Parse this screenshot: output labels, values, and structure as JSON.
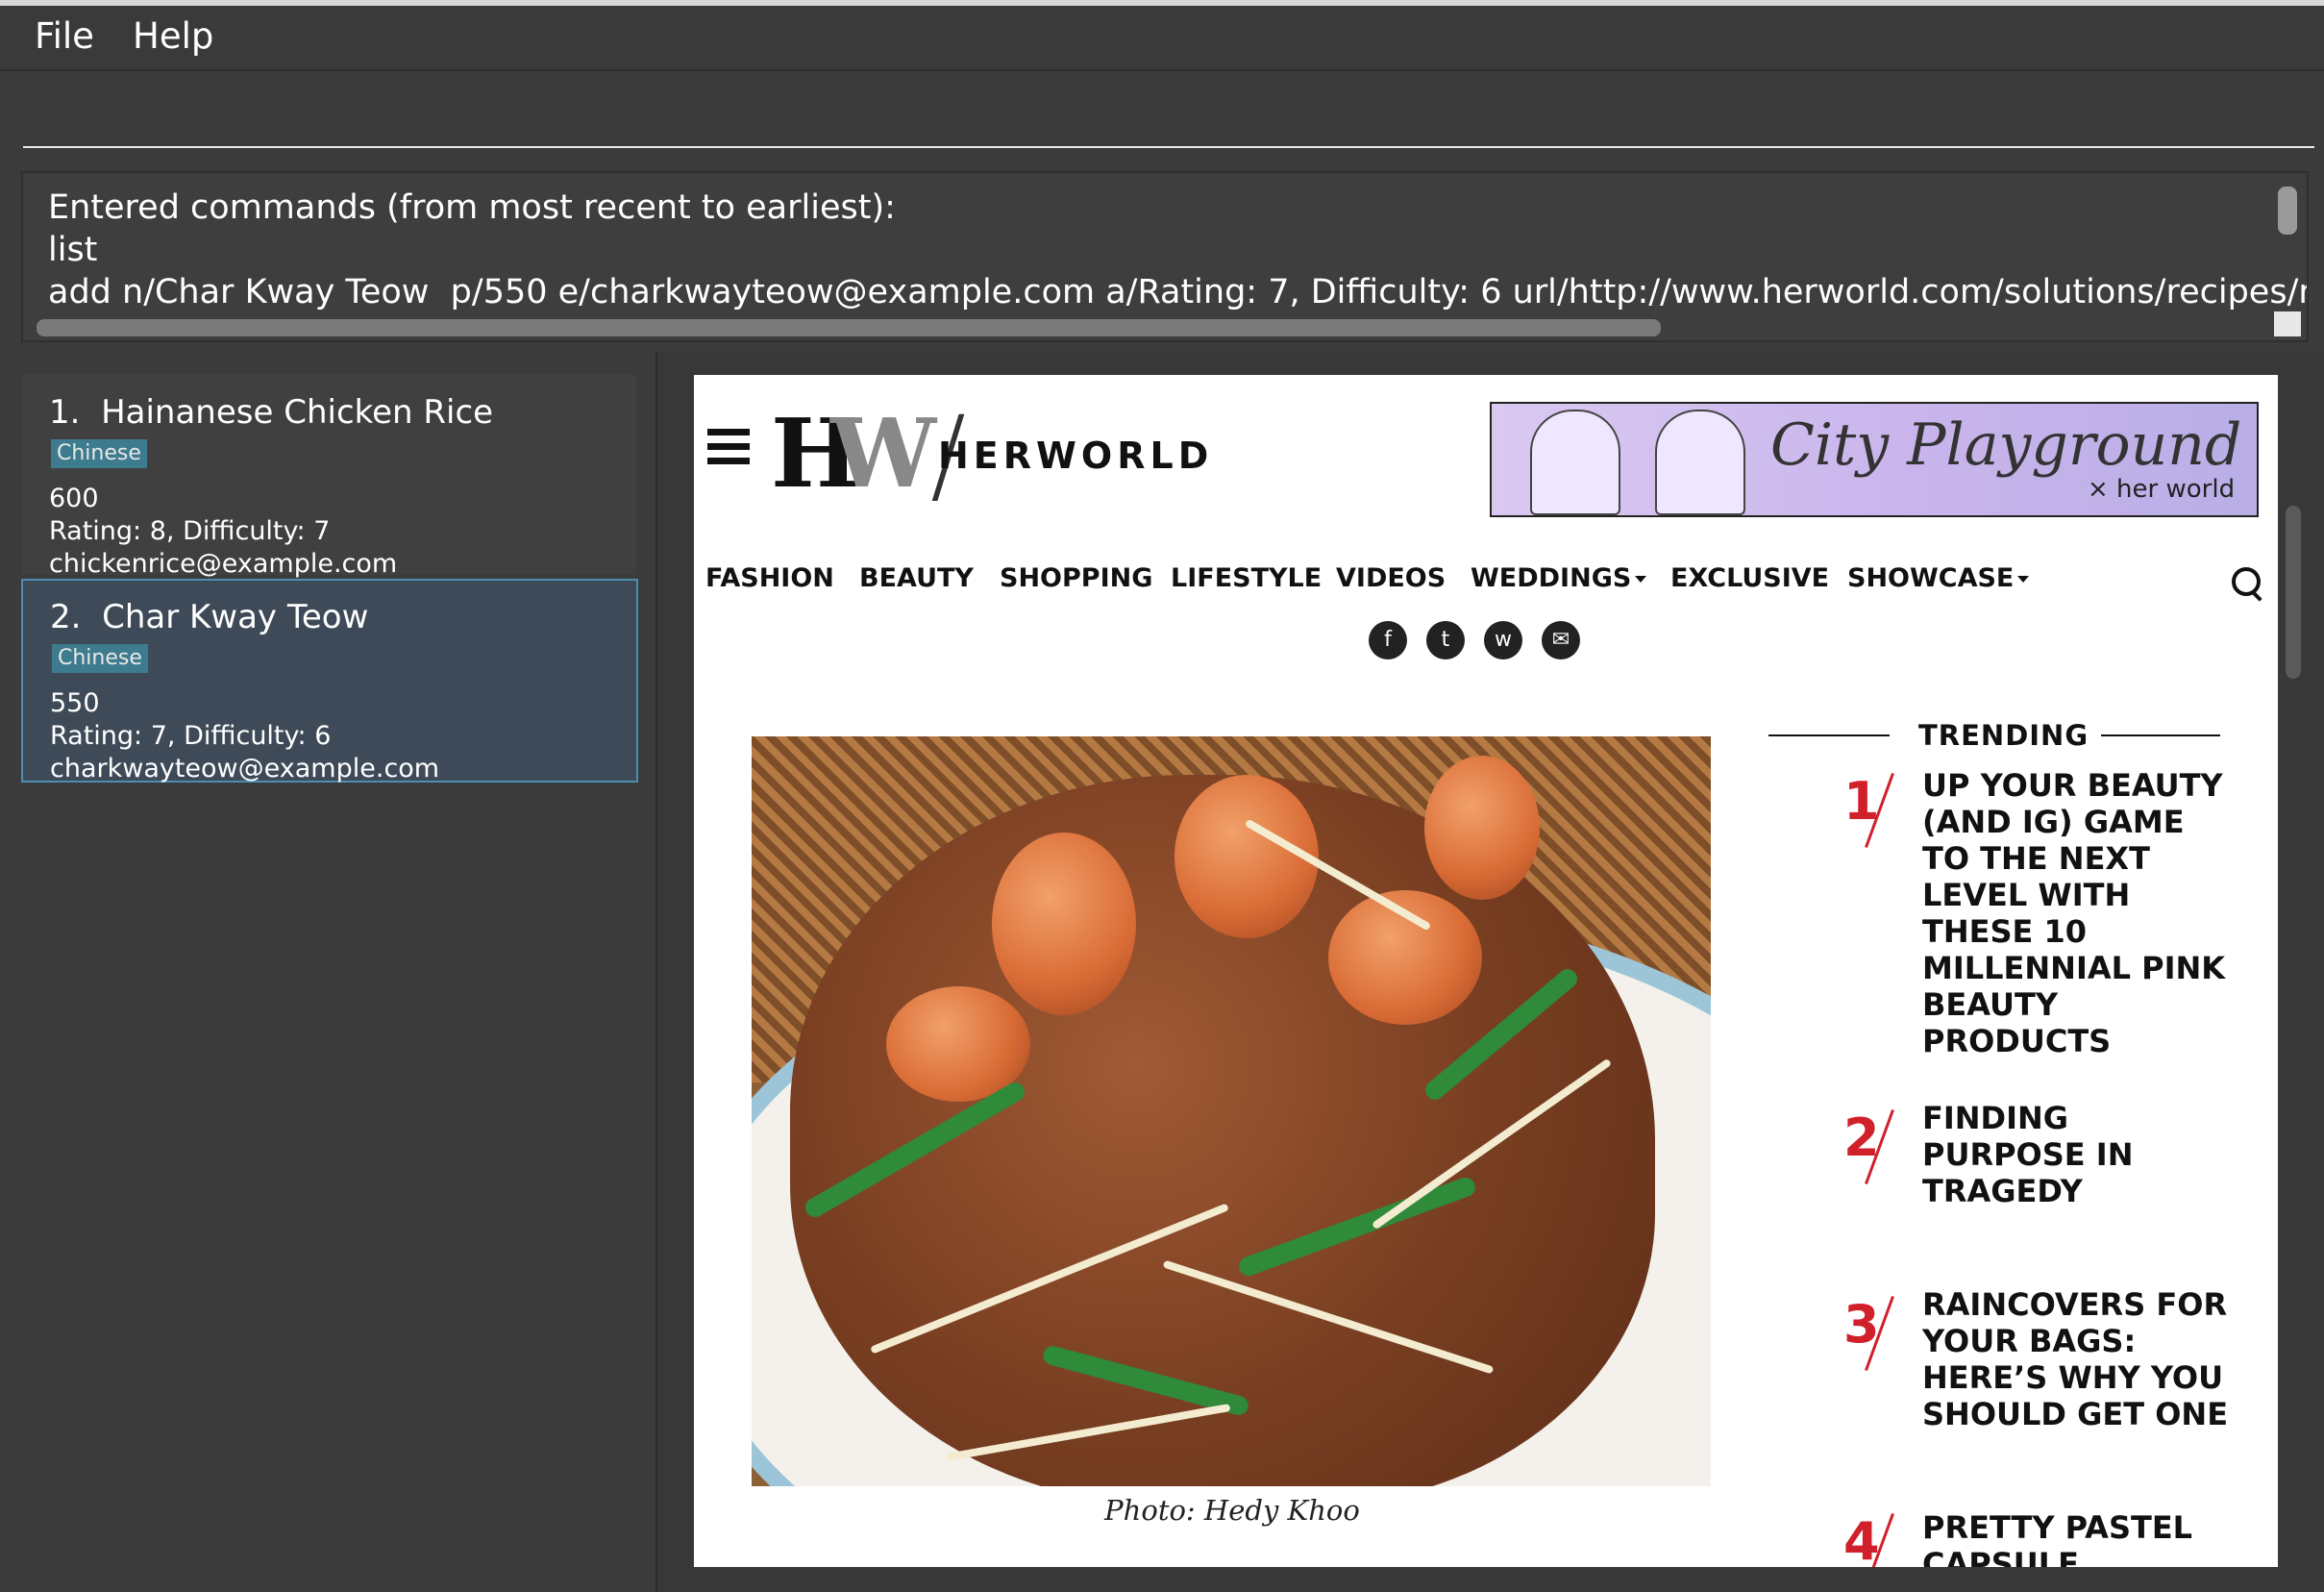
{
  "menu": {
    "file": "File",
    "help": "Help"
  },
  "command_input": {
    "value": "",
    "placeholder": ""
  },
  "result_display": {
    "lines": [
      "Entered commands (from most recent to earliest):",
      "list",
      "add n/Char Kway Teow  p/550 e/charkwayteow@example.com a/Rating: 7, Difficulty: 6 url/http://www.herworld.com/solutions/recipes/recipe-l"
    ]
  },
  "recipes": [
    {
      "index": "1.",
      "name": "Hainanese Chicken Rice",
      "tag": "Chinese",
      "phone": "600",
      "address": "Rating: 8, Difficulty: 7",
      "email": "chickenrice@example.com"
    },
    {
      "index": "2.",
      "name": "Char Kway Teow",
      "tag": "Chinese",
      "phone": "550",
      "address": "Rating: 7, Difficulty: 6",
      "email": "charkwayteow@example.com"
    }
  ],
  "browser": {
    "logo": {
      "h": "H",
      "w": "W",
      "wordmark": "HERWORLD"
    },
    "banner": {
      "script": "City Playground",
      "sub": "× her world"
    },
    "nav": [
      "FASHION",
      "BEAUTY",
      "SHOPPING",
      "LIFESTYLE",
      "VIDEOS",
      "WEDDINGS",
      "EXCLUSIVE",
      "SHOWCASE"
    ],
    "caption": "Photo: Hedy Khoo",
    "trending": {
      "title": "TRENDING",
      "items": [
        {
          "num": "1",
          "text": "UP YOUR BEAUTY (AND IG) GAME TO THE NEXT LEVEL WITH THESE 10 MILLENNIAL PINK BEAUTY PRODUCTS"
        },
        {
          "num": "2",
          "text": "FINDING PURPOSE IN TRAGEDY"
        },
        {
          "num": "3",
          "text": "RAINCOVERS FOR YOUR BAGS: HERE’S WHY YOU SHOULD GET ONE"
        },
        {
          "num": "4",
          "text": "PRETTY PASTEL CAPSULE"
        }
      ]
    }
  }
}
